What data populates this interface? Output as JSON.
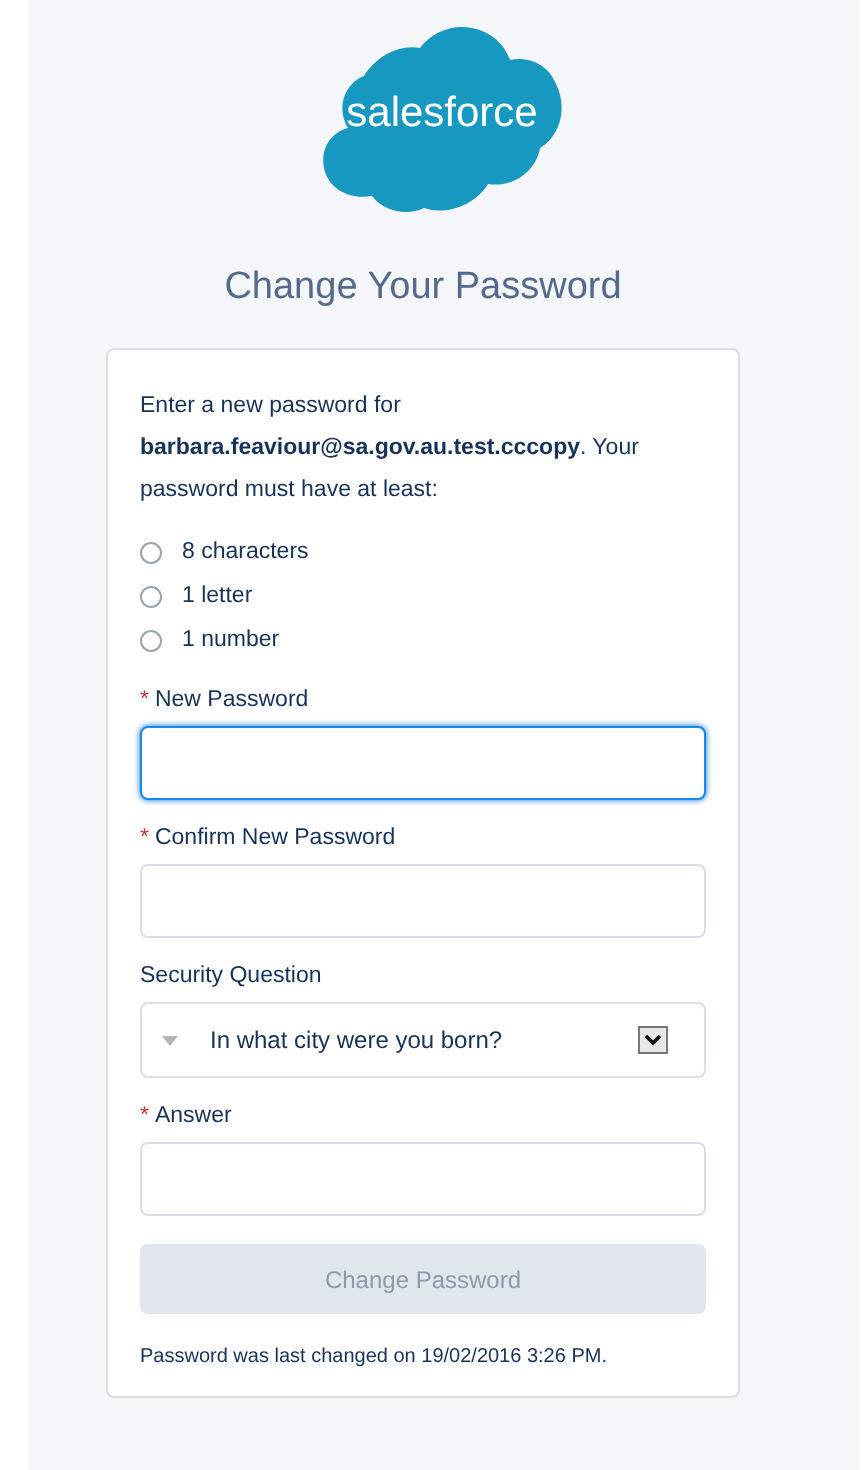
{
  "logo": {
    "text": "salesforce"
  },
  "title": "Change Your Password",
  "intro": "Enter a new password for **barbara.feaviour@sa.gov.au.test.cccopy**. Your password must have at least:",
  "requirements": [
    {
      "label": "8 characters",
      "checked": false
    },
    {
      "label": "1 letter",
      "checked": false
    },
    {
      "label": "1 number",
      "checked": false
    }
  ],
  "fields": [
    {
      "kind": "text",
      "marker": "*",
      "label": "New Password",
      "focused": true
    },
    {
      "kind": "text",
      "marker": "*",
      "label": "Confirm New Password",
      "focused": false
    },
    {
      "kind": "select",
      "label": "Security Question",
      "focused": false,
      "value": "In what city were you born?"
    },
    {
      "kind": "text",
      "marker": "*",
      "label": "Answer",
      "focused": false
    }
  ],
  "submit": {
    "label": "Change Password",
    "disabled": true
  },
  "footer": "Password was last changed on 19/02/2016 3:26 PM."
}
